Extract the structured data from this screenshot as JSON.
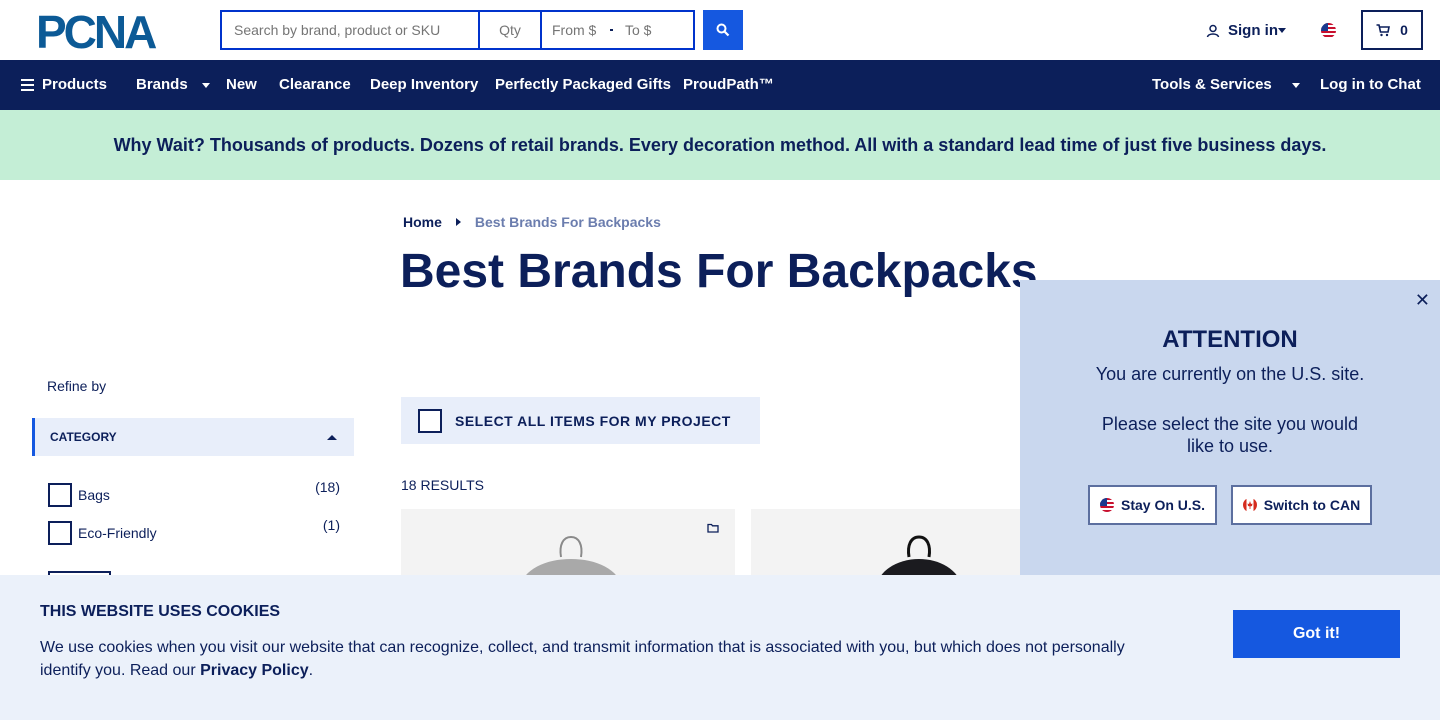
{
  "header": {
    "logo_text": "PCNA",
    "search_placeholder": "Search by brand, product or SKU",
    "qty_placeholder": "Qty",
    "price_from_placeholder": "From $",
    "price_to_placeholder": "To $",
    "signin_label": "Sign in",
    "cart_count": "0"
  },
  "nav": {
    "products": "Products",
    "brands": "Brands",
    "new": "New",
    "clearance": "Clearance",
    "deep_inventory": "Deep Inventory",
    "gifts": "Perfectly Packaged Gifts",
    "proudpath": "ProudPath™",
    "tools": "Tools & Services",
    "chat": "Log in to Chat"
  },
  "banner": {
    "text": "Why Wait? Thousands of products. Dozens of retail brands. Every decoration method. All with a standard lead time of just five business days."
  },
  "breadcrumb": {
    "home": "Home",
    "current": "Best Brands For Backpacks"
  },
  "page_title": "Best Brands For Backpacks",
  "sidebar": {
    "refine_label": "Refine by",
    "category_label": "CATEGORY",
    "filters": [
      {
        "label": "Bags",
        "count": "(18)"
      },
      {
        "label": "Eco-Friendly",
        "count": "(1)"
      }
    ]
  },
  "results": {
    "select_all_label": "SELECT ALL ITEMS FOR MY PROJECT",
    "count_label": "18 RESULTS"
  },
  "attention": {
    "title": "ATTENTION",
    "line1": "You are currently on the U.S. site.",
    "line2": "Please select the site you would like to use.",
    "stay_label": "Stay On U.S.",
    "switch_label": "Switch to CAN"
  },
  "cookie": {
    "title": "THIS WEBSITE USES COOKIES",
    "text_before": "We use cookies when you visit our website that can recognize, collect, and transmit information that is associated with you, but which does not personally identify you. Read our ",
    "link": "Privacy Policy",
    "text_after": ".",
    "button": "Got it!"
  },
  "colors": {
    "navy": "#0c1f5a",
    "accent_blue": "#1558e0",
    "banner_green": "#c4eed6",
    "modal_bg": "#c9d7ee"
  }
}
